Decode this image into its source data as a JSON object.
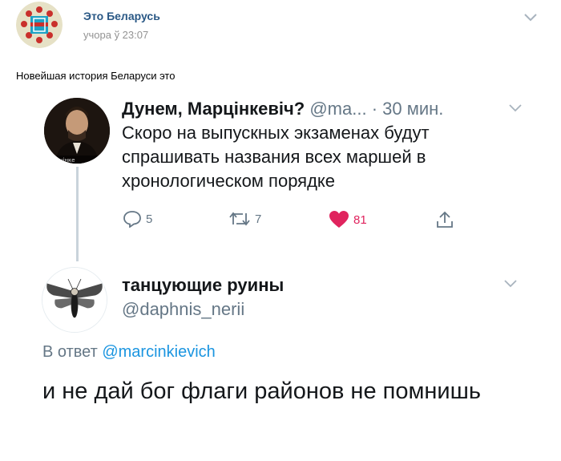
{
  "vk_post": {
    "author": "Это Беларусь",
    "time": "учора ў 23:07",
    "text": "Новейшая история Беларуси это"
  },
  "tweet1": {
    "author_name": "Дунем, Марцінкевіч?",
    "handle": "@ma...",
    "time": "· 30 мин.",
    "body": "Скоро на выпускных экзаменах будут спрашивать названия всех маршей в хронологическом порядке",
    "avatar_caption": "Марцінке",
    "reply_count": "5",
    "retweet_count": "7",
    "like_count": "81"
  },
  "tweet2": {
    "author_name": "танцующие руины",
    "handle": "@daphnis_nerii",
    "reply_prefix": "В ответ",
    "reply_mention": "@marcinkievich",
    "body": "и не дай бог флаги районов не помнишь"
  },
  "colors": {
    "vk_link": "#2a5885",
    "twitter_blue": "#1b95e0",
    "muted": "#657786",
    "like_red": "#e0245e"
  }
}
